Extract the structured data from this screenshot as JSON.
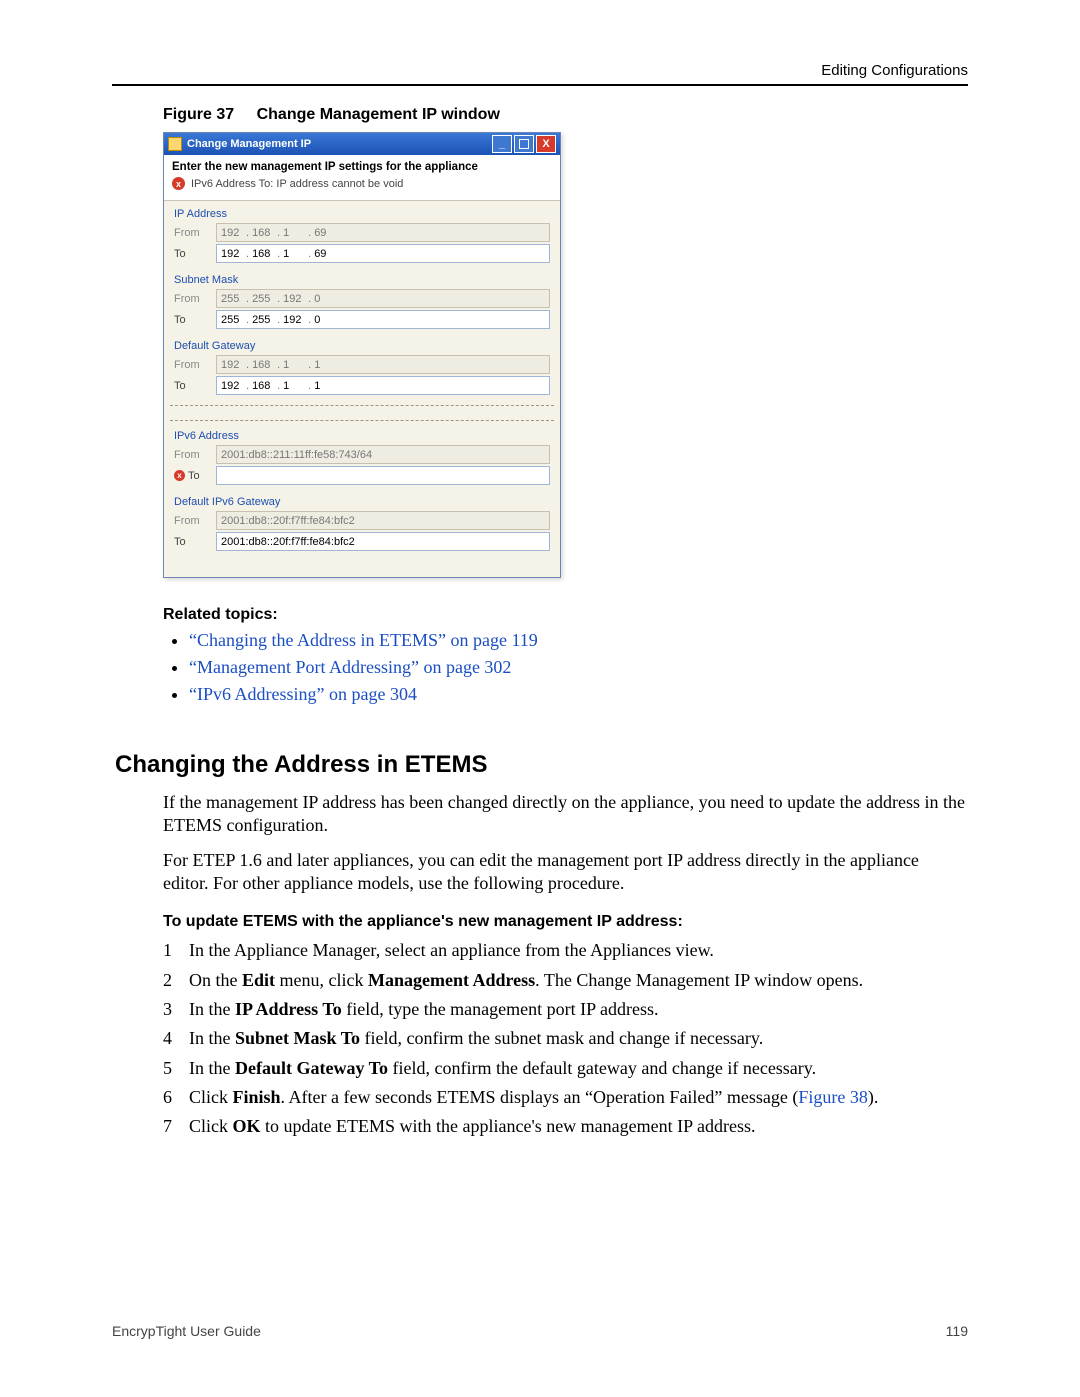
{
  "header": {
    "section": "Editing Configurations"
  },
  "figure": {
    "label": "Figure 37",
    "title": "Change Management IP window"
  },
  "window": {
    "title": "Change Management IP",
    "heading": "Enter the new management IP settings for the appliance",
    "error": "IPv6 Address To: IP address cannot be void",
    "sections": {
      "ip": {
        "title": "IP Address",
        "from_label": "From",
        "to_label": "To",
        "from": [
          "192",
          "168",
          "1",
          "69"
        ],
        "to": [
          "192",
          "168",
          "1",
          "69"
        ]
      },
      "mask": {
        "title": "Subnet Mask",
        "from_label": "From",
        "to_label": "To",
        "from": [
          "255",
          "255",
          "192",
          "0"
        ],
        "to": [
          "255",
          "255",
          "192",
          "0"
        ]
      },
      "gw": {
        "title": "Default Gateway",
        "from_label": "From",
        "to_label": "To",
        "from": [
          "192",
          "168",
          "1",
          "1"
        ],
        "to": [
          "192",
          "168",
          "1",
          "1"
        ]
      },
      "ipv6": {
        "title": "IPv6 Address",
        "from_label": "From",
        "to_label": "To",
        "from": "2001:db8::211:11ff:fe58:743/64",
        "to": ""
      },
      "ipv6gw": {
        "title": "Default IPv6 Gateway",
        "from_label": "From",
        "to_label": "To",
        "from": "2001:db8::20f:f7ff:fe84:bfc2",
        "to": "2001:db8::20f:f7ff:fe84:bfc2"
      }
    }
  },
  "related": {
    "heading": "Related topics:",
    "items": [
      "“Changing the Address in ETEMS” on page 119",
      "“Management Port Addressing” on page 302",
      "“IPv6 Addressing” on page 304"
    ]
  },
  "body": {
    "h2": "Changing the Address in ETEMS",
    "p1": "If the management IP address has been changed directly on the appliance, you need to update the address in the ETEMS configuration.",
    "p2": "For ETEP 1.6 and later appliances, you can edit the management port IP address directly in the appliance editor. For other appliance models, use the following procedure.",
    "procHeading": "To update ETEMS with the appliance's new management IP address:",
    "steps": {
      "s1": "In the Appliance Manager, select an appliance from the Appliances view.",
      "s2a": "On the ",
      "s2b": "Edit",
      "s2c": " menu, click ",
      "s2d": "Management Address",
      "s2e": ". The Change Management IP window opens.",
      "s3a": "In the ",
      "s3b": "IP Address To",
      "s3c": " field, type the management port IP address.",
      "s4a": "In the ",
      "s4b": "Subnet Mask To",
      "s4c": " field, confirm the subnet mask and change if necessary.",
      "s5a": "In the ",
      "s5b": "Default Gateway To",
      "s5c": " field, confirm the default gateway and change if necessary.",
      "s6a": "Click ",
      "s6b": "Finish",
      "s6c": ". After a few seconds ETEMS displays an “Operation Failed” message (",
      "s6d": "Figure 38",
      "s6e": ").",
      "s7a": "Click ",
      "s7b": "OK",
      "s7c": " to update ETEMS with the appliance's new management IP address."
    }
  },
  "footer": {
    "left": "EncrypTight User Guide",
    "right": "119"
  }
}
